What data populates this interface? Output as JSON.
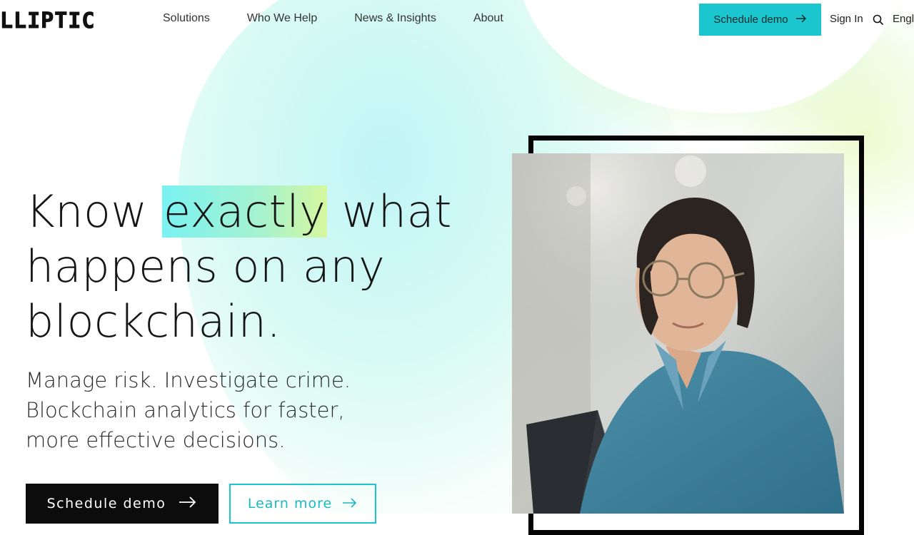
{
  "header": {
    "logo_text": "LLIPTIC",
    "nav": [
      "Solutions",
      "Who We Help",
      "News & Insights",
      "About"
    ],
    "demo_label": "Schedule demo",
    "signin_label": "Sign In",
    "lang_label": "Engl"
  },
  "hero": {
    "title_pre": "Know ",
    "title_highlight": "exactly",
    "title_post": " what",
    "title_line2": "happens on any",
    "title_line3": "blockchain.",
    "subtitle_line1": "Manage risk. Investigate crime.",
    "subtitle_line2": "Blockchain analytics for faster,",
    "subtitle_line3": "more effective decisions.",
    "primary_cta": "Schedule demo",
    "secondary_cta": "Learn more"
  },
  "colors": {
    "accent": "#1bc6cf",
    "dark": "#0c0c0c",
    "highlight_start": "#7af2f2",
    "highlight_end": "#d6f79e"
  },
  "icons": {
    "arrow": "arrow-right-icon",
    "search": "search-icon"
  }
}
